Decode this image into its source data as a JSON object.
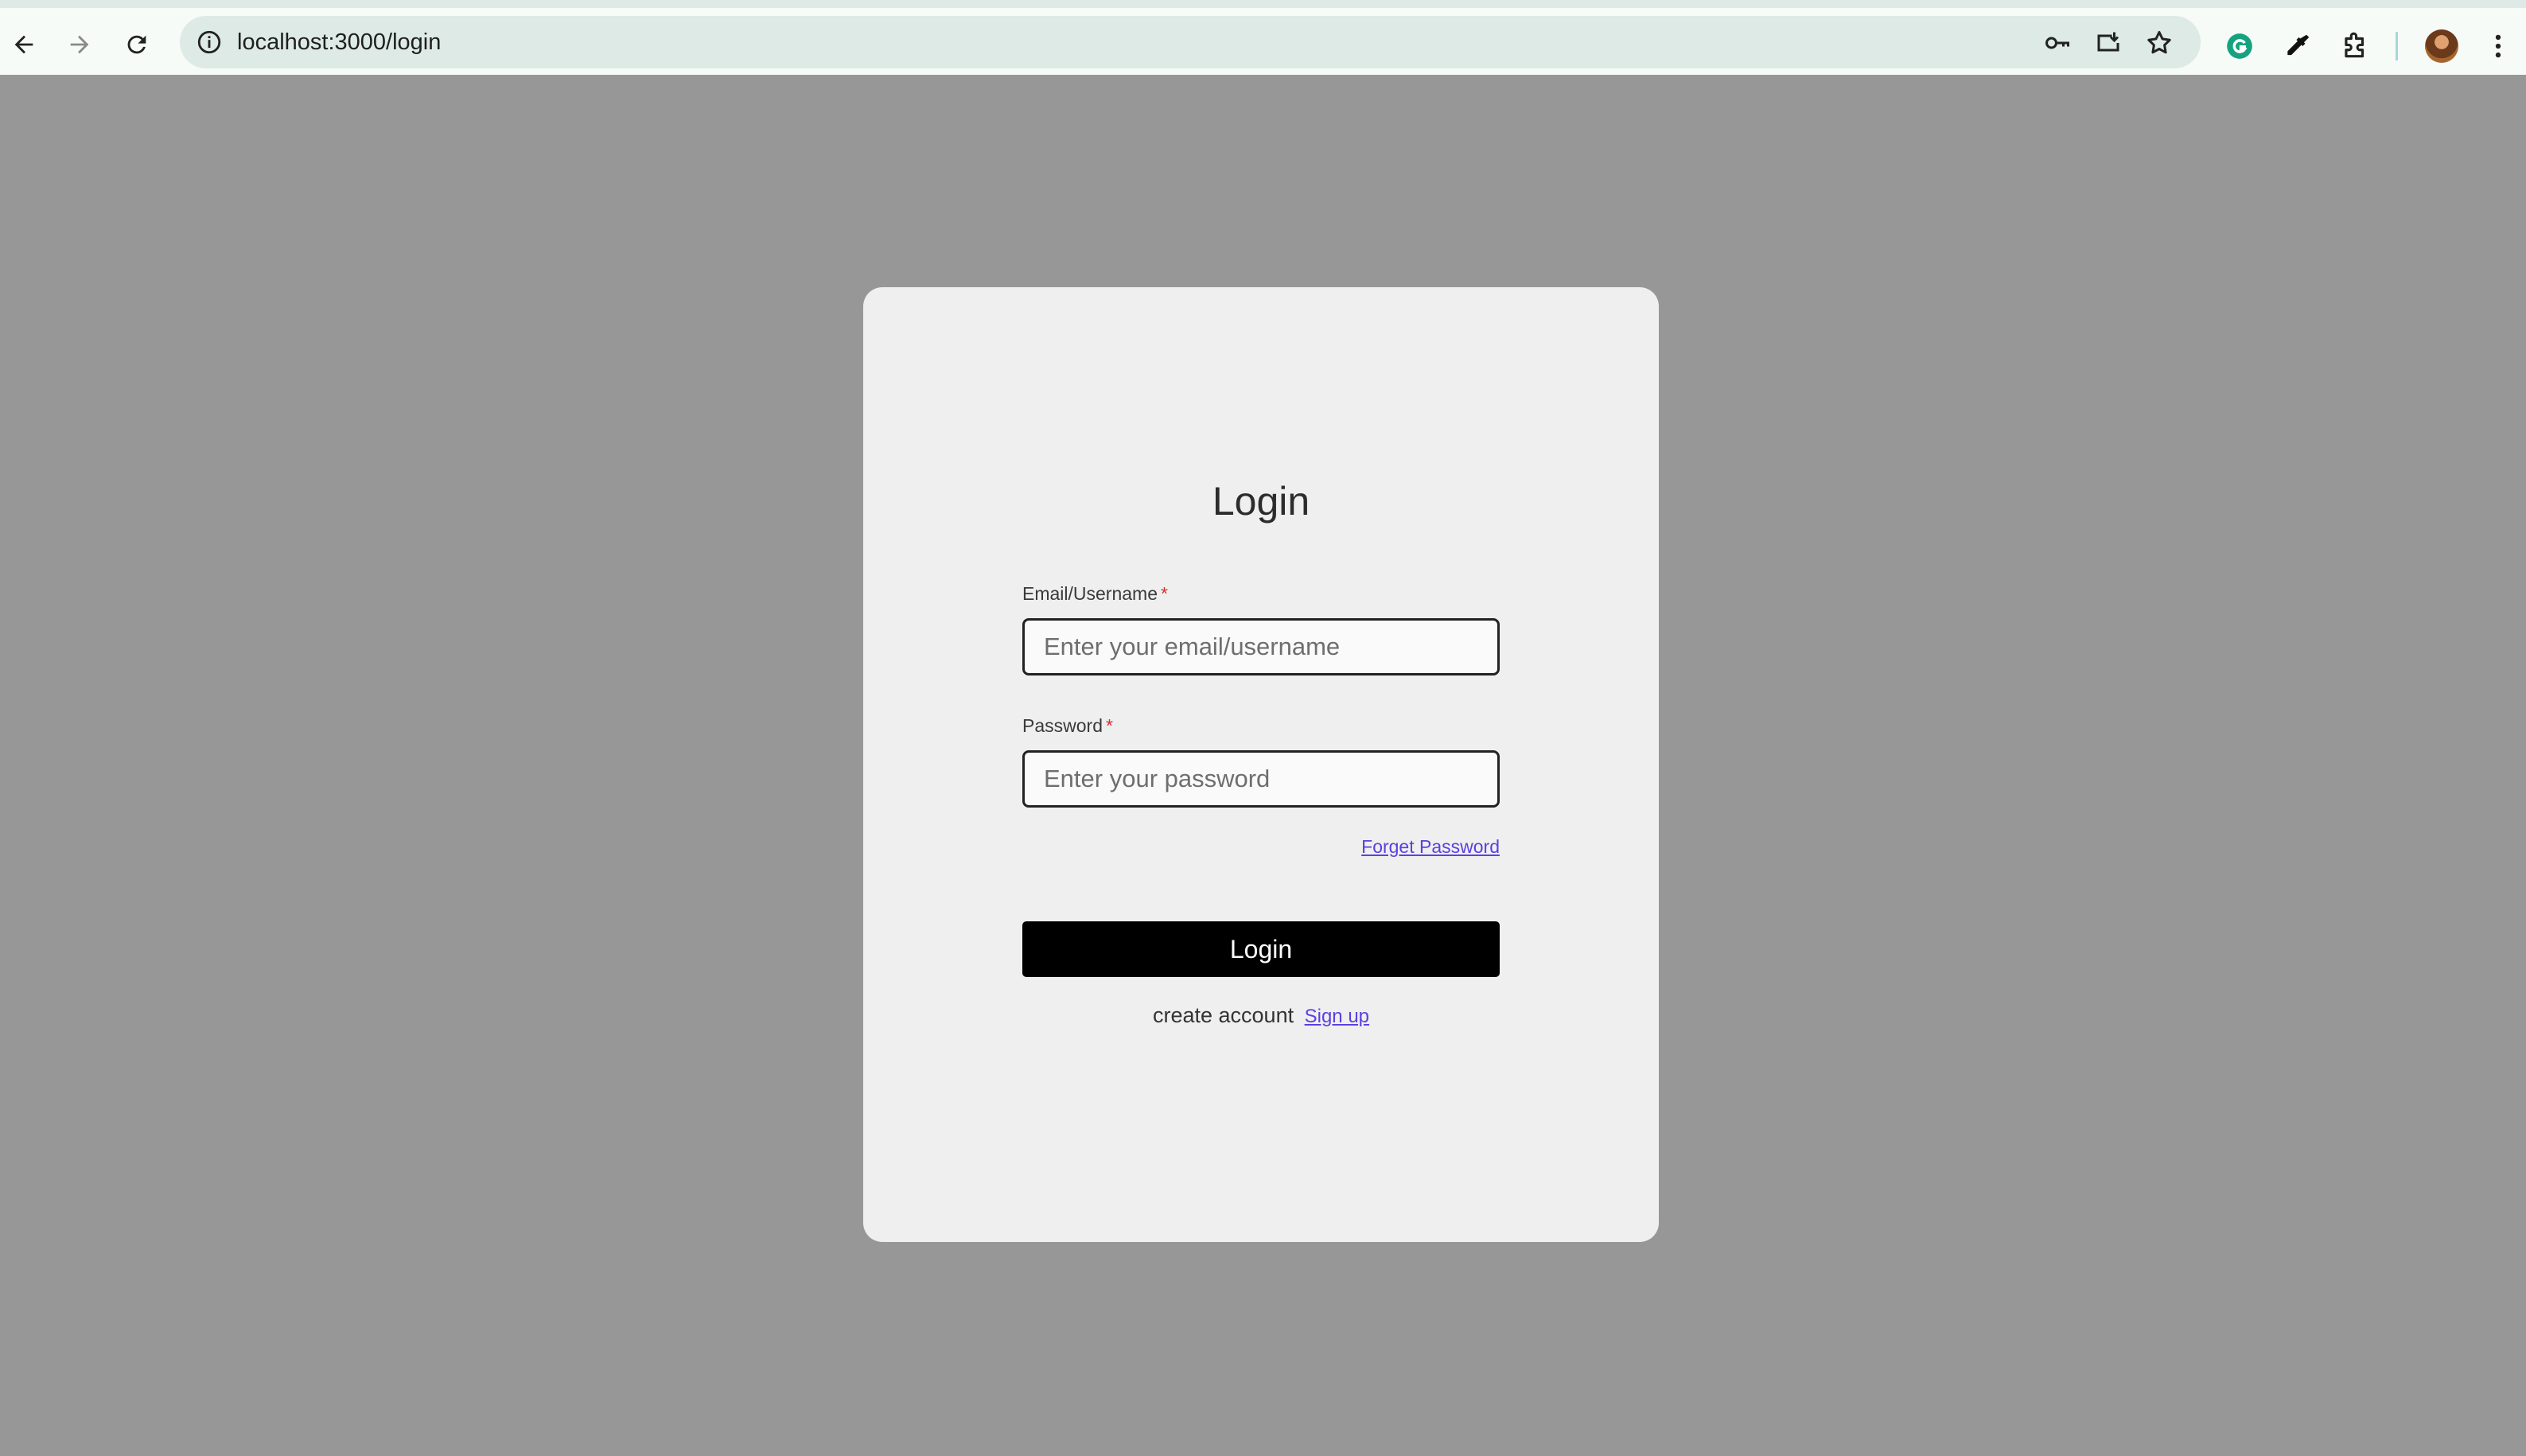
{
  "browser": {
    "url": "localhost:3000/login",
    "icons": {
      "back": "arrow-left-icon",
      "forward": "arrow-right-icon",
      "reload": "reload-icon",
      "site_info": "info-icon",
      "password_key": "key-icon",
      "install": "install-app-icon",
      "bookmark": "star-icon",
      "grammarly": "grammarly-icon",
      "eyedropper": "eyedropper-icon",
      "extensions": "puzzle-icon",
      "profile": "avatar",
      "menu": "kebab-menu-icon"
    }
  },
  "login": {
    "title": "Login",
    "email_label": "Email/Username",
    "email_placeholder": "Enter your email/username",
    "password_label": "Password",
    "password_placeholder": "Enter your password",
    "required_marker": "*",
    "forgot_link": "Forget Password",
    "submit_label": "Login",
    "signup_prompt": "create account",
    "signup_link": "Sign up"
  },
  "colors": {
    "background": "#979797",
    "card": "#efefef",
    "button": "#000000",
    "link": "#5b40e0",
    "required": "#d32f2f"
  }
}
